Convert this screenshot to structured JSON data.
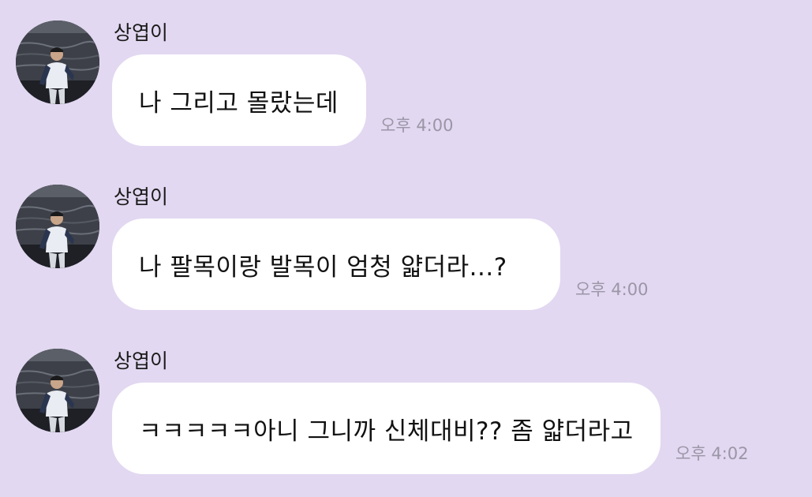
{
  "colors": {
    "background": "#E2D8F1",
    "bubble": "#FFFFFF",
    "text": "#111111",
    "time": "#9B96A6"
  },
  "messages": [
    {
      "sender": "상엽이",
      "text": "나 그리고 몰랐는데",
      "time": "오후 4:00",
      "avatar_icon": "profile-photo"
    },
    {
      "sender": "상엽이",
      "text": "나 팔목이랑 발목이 엄청 얇더라...?",
      "time": "오후 4:00",
      "avatar_icon": "profile-photo"
    },
    {
      "sender": "상엽이",
      "text": "ㅋㅋㅋㅋㅋ아니 그니까 신체대비?? 좀 얇더라고",
      "time": "오후 4:02",
      "avatar_icon": "profile-photo"
    }
  ]
}
